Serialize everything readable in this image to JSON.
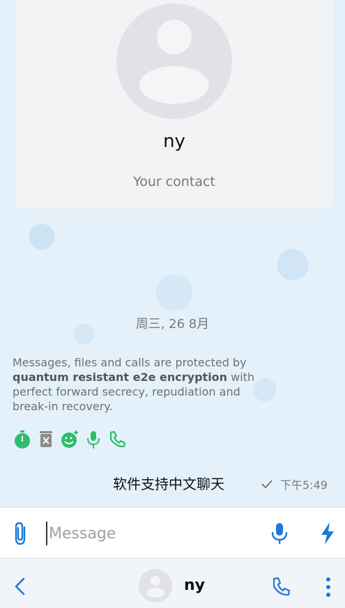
{
  "contact_card": {
    "name": "ny",
    "subtitle": "Your contact",
    "avatar_icon": "avatar-placeholder-icon"
  },
  "chat": {
    "date_separator": "周三, 26 8月",
    "e2e_notice": {
      "part1": "Messages, files and calls are protected by ",
      "bold": "quantum resistant e2e encryption",
      "part2": " with perfect forward secrecy, repudiation and break-in recovery."
    },
    "feature_icons": [
      "timer-icon",
      "delete-icon",
      "reaction-icon",
      "voice-icon",
      "call-icon"
    ],
    "feature_color": "#2dbe6c",
    "messages": [
      {
        "text": "软件支持中文聊天",
        "time": "下午5:49",
        "status_icon": "check-icon"
      }
    ]
  },
  "composer": {
    "placeholder": "Message",
    "value": "",
    "accent": "#1e78d6",
    "icons": [
      "attach-icon",
      "mic-icon",
      "bolt-icon"
    ]
  },
  "bottom_bar": {
    "name": "ny",
    "icons": [
      "back-icon",
      "avatar-icon",
      "call-icon",
      "more-icon"
    ]
  }
}
